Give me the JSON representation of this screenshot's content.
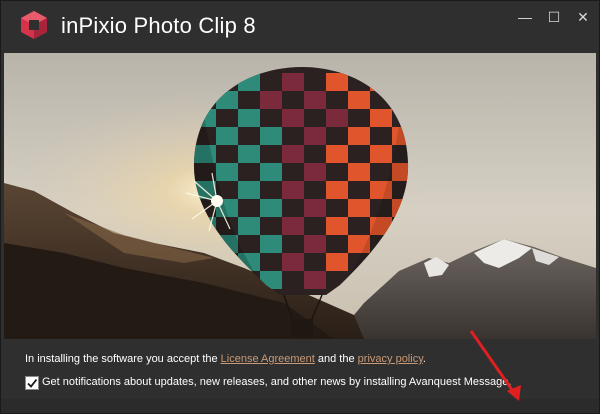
{
  "app": {
    "title": "inPixio Photo Clip 8"
  },
  "window_controls": {
    "minimize": "—",
    "maximize": "☐",
    "close": "✕"
  },
  "footer": {
    "license_prefix": "In installing the software you accept the ",
    "license_link": "License Agreement",
    "license_middle": " and the ",
    "privacy_link": "privacy policy",
    "license_suffix": ".",
    "notify_checked": true,
    "notify_label": "Get notifications about updates, new releases, and other news by installing Avanquest Message."
  },
  "colors": {
    "link": "#c99a77",
    "accent_logo": "#d4334a",
    "annotation_arrow": "#e02020"
  }
}
